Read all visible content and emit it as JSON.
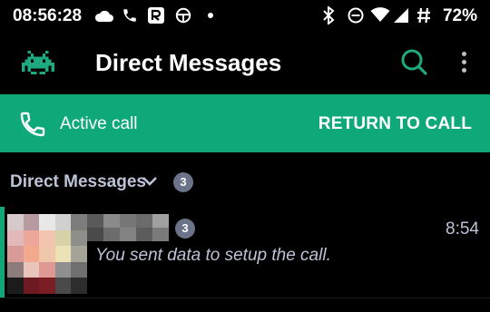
{
  "status_bar": {
    "time": "08:56:28",
    "battery": "72%",
    "icons": [
      "cloud-icon",
      "phone-icon",
      "r-app-icon",
      "steering-wheel-icon",
      "dot-icon",
      "bluetooth-icon",
      "do-not-disturb-icon",
      "wifi-icon",
      "signal-icon",
      "hash-icon"
    ]
  },
  "toolbar": {
    "title": "Direct Messages",
    "logo_icon": "space-invader-icon",
    "search_icon": "search-icon",
    "more_icon": "more-vert-icon"
  },
  "call_bar": {
    "label": "Active call",
    "action": "RETURN TO CALL",
    "icon": "phone-icon"
  },
  "section": {
    "title": "Direct Messages",
    "count": "3"
  },
  "conversations": [
    {
      "unread_count": "3",
      "time": "8:54",
      "last_message": "You sent data to setup the call."
    }
  ],
  "colors": {
    "accent": "#0fa878",
    "background": "#000000",
    "muted_text": "#bcc3d6",
    "badge": "#6a7388"
  }
}
